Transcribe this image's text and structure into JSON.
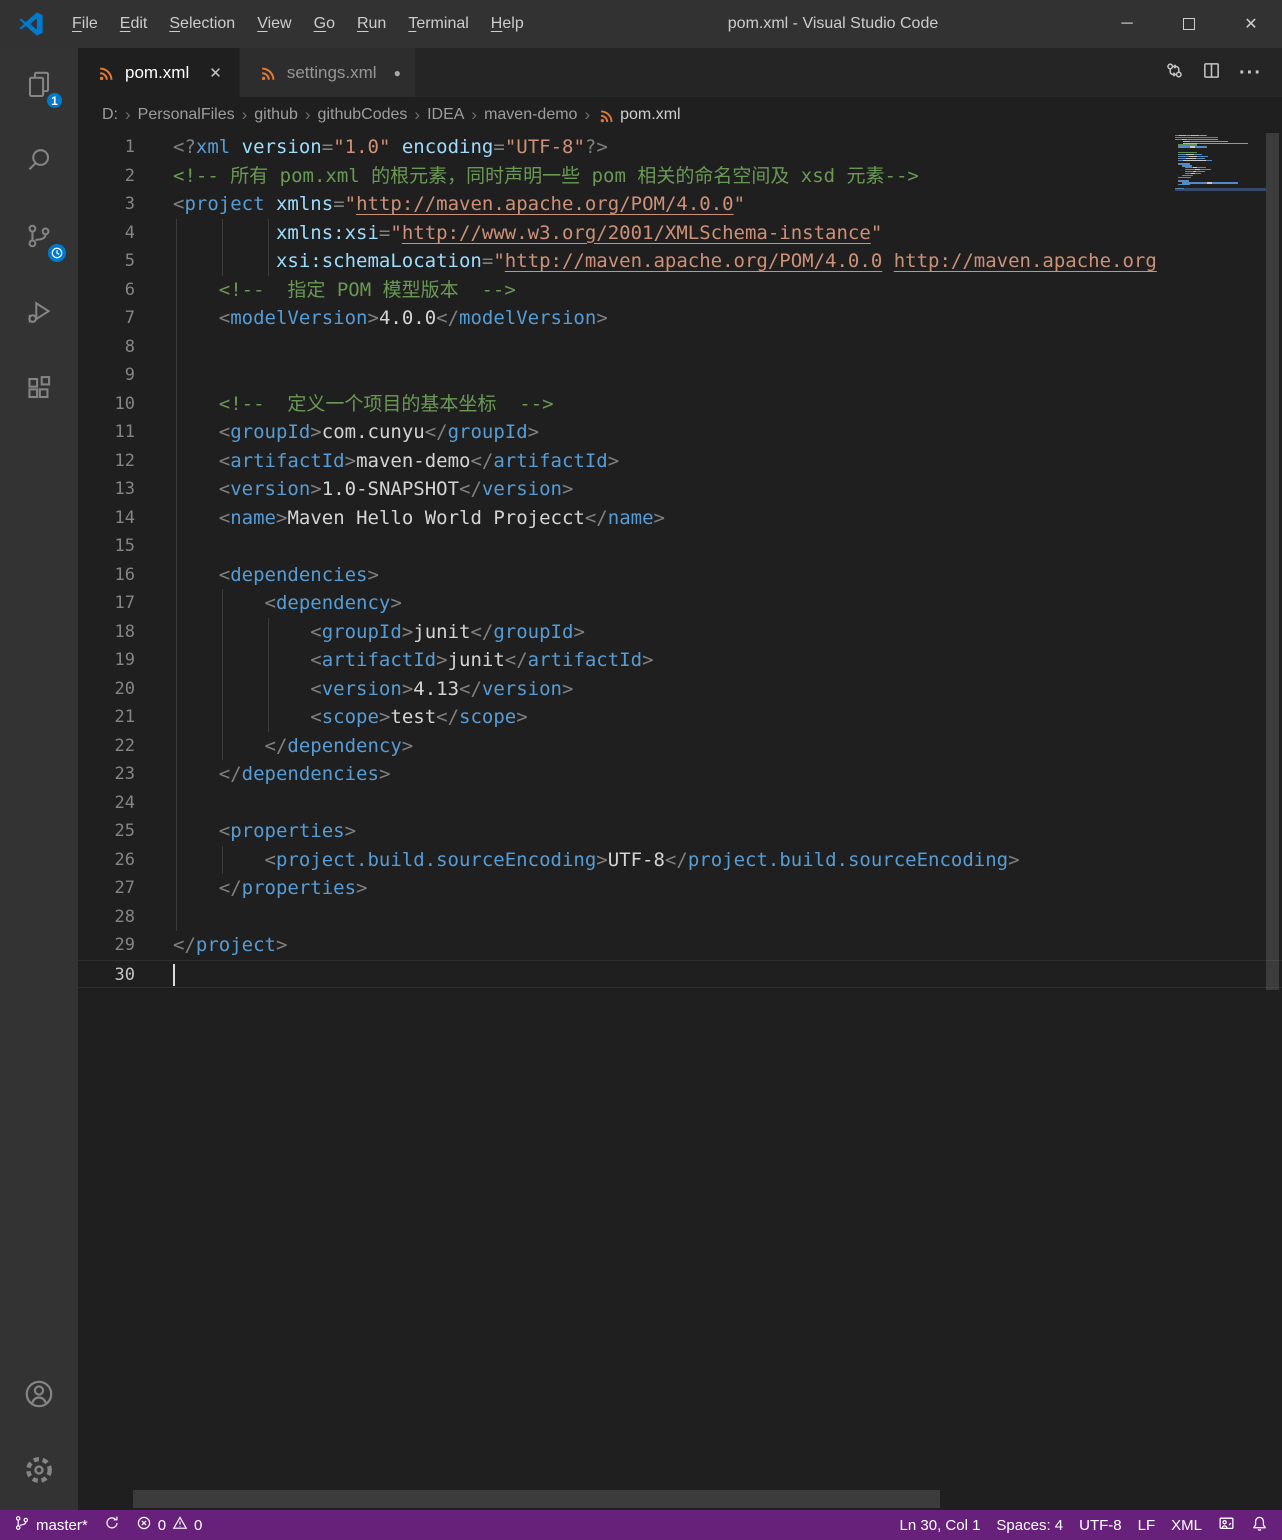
{
  "window": {
    "title": "pom.xml - Visual Studio Code",
    "controls": {
      "minimize": "─",
      "close": "✕"
    }
  },
  "menu": {
    "items": [
      "File",
      "Edit",
      "Selection",
      "View",
      "Go",
      "Run",
      "Terminal",
      "Help"
    ]
  },
  "activity_bar": {
    "explorer_badge": "1",
    "items": [
      "explorer",
      "search",
      "source-control",
      "run-and-debug",
      "extensions"
    ],
    "bottom_items": [
      "accounts",
      "manage"
    ]
  },
  "tab_bar": {
    "tabs": [
      {
        "label": "pom.xml",
        "state": "active",
        "close_glyph": "✕"
      },
      {
        "label": "settings.xml",
        "state": "modified",
        "dot_glyph": "●"
      }
    ],
    "more_glyph": "···"
  },
  "breadcrumb": {
    "path": [
      "D:",
      "PersonalFiles",
      "github",
      "githubCodes",
      "IDEA",
      "maven-demo"
    ],
    "file": "pom.xml",
    "separator": "›"
  },
  "editor": {
    "cursor": {
      "line": 30,
      "col": 1
    },
    "lines": [
      {
        "n": 1,
        "ind": 0,
        "g": [],
        "segs": [
          [
            "pu",
            "<?"
          ],
          [
            "tag",
            "xml"
          ],
          [
            "txt",
            " "
          ],
          [
            "attr",
            "version"
          ],
          [
            "pu",
            "="
          ],
          [
            "str",
            "\"1.0\""
          ],
          [
            "txt",
            " "
          ],
          [
            "attr",
            "encoding"
          ],
          [
            "pu",
            "="
          ],
          [
            "str",
            "\"UTF-8\""
          ],
          [
            "pu",
            "?>"
          ]
        ]
      },
      {
        "n": 2,
        "ind": 0,
        "g": [],
        "segs": [
          [
            "com",
            "<!-- 所有 pom.xml 的根元素，同时声明一些 pom 相关的命名空间及 xsd 元素-->"
          ]
        ]
      },
      {
        "n": 3,
        "ind": 0,
        "g": [],
        "segs": [
          [
            "pu",
            "<"
          ],
          [
            "tag",
            "project"
          ],
          [
            "txt",
            " "
          ],
          [
            "attr",
            "xmlns"
          ],
          [
            "pu",
            "="
          ],
          [
            "str",
            "\""
          ],
          [
            "url",
            "http://maven.apache.org/POM/4.0.0"
          ],
          [
            "str",
            "\""
          ]
        ]
      },
      {
        "n": 4,
        "ind": 9,
        "g": [
          0,
          4,
          8
        ],
        "segs": [
          [
            "attr",
            "xmlns:xsi"
          ],
          [
            "pu",
            "="
          ],
          [
            "str",
            "\""
          ],
          [
            "url",
            "http://www.w3.org/2001/XMLSchema-instance"
          ],
          [
            "str",
            "\""
          ]
        ]
      },
      {
        "n": 5,
        "ind": 9,
        "g": [
          0,
          4,
          8
        ],
        "segs": [
          [
            "attr",
            "xsi:schemaLocation"
          ],
          [
            "pu",
            "="
          ],
          [
            "str",
            "\""
          ],
          [
            "url",
            "http://maven.apache.org/POM/4.0.0"
          ],
          [
            "str",
            " "
          ],
          [
            "url",
            "http://maven.apache.org"
          ]
        ]
      },
      {
        "n": 6,
        "ind": 4,
        "g": [
          0
        ],
        "segs": [
          [
            "com",
            "<!--  指定 POM 模型版本  -->"
          ]
        ]
      },
      {
        "n": 7,
        "ind": 4,
        "g": [
          0
        ],
        "segs": [
          [
            "pu",
            "<"
          ],
          [
            "tag",
            "modelVersion"
          ],
          [
            "pu",
            ">"
          ],
          [
            "txt",
            "4.0.0"
          ],
          [
            "pu",
            "</"
          ],
          [
            "tag",
            "modelVersion"
          ],
          [
            "pu",
            ">"
          ]
        ]
      },
      {
        "n": 8,
        "ind": 0,
        "g": [
          0
        ],
        "segs": []
      },
      {
        "n": 9,
        "ind": 0,
        "g": [
          0
        ],
        "segs": []
      },
      {
        "n": 10,
        "ind": 4,
        "g": [
          0
        ],
        "segs": [
          [
            "com",
            "<!--  定义一个项目的基本坐标  -->"
          ]
        ]
      },
      {
        "n": 11,
        "ind": 4,
        "g": [
          0
        ],
        "segs": [
          [
            "pu",
            "<"
          ],
          [
            "tag",
            "groupId"
          ],
          [
            "pu",
            ">"
          ],
          [
            "txt",
            "com.cunyu"
          ],
          [
            "pu",
            "</"
          ],
          [
            "tag",
            "groupId"
          ],
          [
            "pu",
            ">"
          ]
        ]
      },
      {
        "n": 12,
        "ind": 4,
        "g": [
          0
        ],
        "segs": [
          [
            "pu",
            "<"
          ],
          [
            "tag",
            "artifactId"
          ],
          [
            "pu",
            ">"
          ],
          [
            "txt",
            "maven-demo"
          ],
          [
            "pu",
            "</"
          ],
          [
            "tag",
            "artifactId"
          ],
          [
            "pu",
            ">"
          ]
        ]
      },
      {
        "n": 13,
        "ind": 4,
        "g": [
          0
        ],
        "segs": [
          [
            "pu",
            "<"
          ],
          [
            "tag",
            "version"
          ],
          [
            "pu",
            ">"
          ],
          [
            "txt",
            "1.0-SNAPSHOT"
          ],
          [
            "pu",
            "</"
          ],
          [
            "tag",
            "version"
          ],
          [
            "pu",
            ">"
          ]
        ]
      },
      {
        "n": 14,
        "ind": 4,
        "g": [
          0
        ],
        "segs": [
          [
            "pu",
            "<"
          ],
          [
            "tag",
            "name"
          ],
          [
            "pu",
            ">"
          ],
          [
            "txt",
            "Maven Hello World Projecct"
          ],
          [
            "pu",
            "</"
          ],
          [
            "tag",
            "name"
          ],
          [
            "pu",
            ">"
          ]
        ]
      },
      {
        "n": 15,
        "ind": 0,
        "g": [
          0
        ],
        "segs": []
      },
      {
        "n": 16,
        "ind": 4,
        "g": [
          0
        ],
        "segs": [
          [
            "pu",
            "<"
          ],
          [
            "tag",
            "dependencies"
          ],
          [
            "pu",
            ">"
          ]
        ]
      },
      {
        "n": 17,
        "ind": 8,
        "g": [
          0,
          4
        ],
        "segs": [
          [
            "pu",
            "<"
          ],
          [
            "tag",
            "dependency"
          ],
          [
            "pu",
            ">"
          ]
        ]
      },
      {
        "n": 18,
        "ind": 12,
        "g": [
          0,
          4,
          8
        ],
        "segs": [
          [
            "pu",
            "<"
          ],
          [
            "tag",
            "groupId"
          ],
          [
            "pu",
            ">"
          ],
          [
            "txt",
            "junit"
          ],
          [
            "pu",
            "</"
          ],
          [
            "tag",
            "groupId"
          ],
          [
            "pu",
            ">"
          ]
        ]
      },
      {
        "n": 19,
        "ind": 12,
        "g": [
          0,
          4,
          8
        ],
        "segs": [
          [
            "pu",
            "<"
          ],
          [
            "tag",
            "artifactId"
          ],
          [
            "pu",
            ">"
          ],
          [
            "txt",
            "junit"
          ],
          [
            "pu",
            "</"
          ],
          [
            "tag",
            "artifactId"
          ],
          [
            "pu",
            ">"
          ]
        ]
      },
      {
        "n": 20,
        "ind": 12,
        "g": [
          0,
          4,
          8
        ],
        "segs": [
          [
            "pu",
            "<"
          ],
          [
            "tag",
            "version"
          ],
          [
            "pu",
            ">"
          ],
          [
            "txt",
            "4.13"
          ],
          [
            "pu",
            "</"
          ],
          [
            "tag",
            "version"
          ],
          [
            "pu",
            ">"
          ]
        ]
      },
      {
        "n": 21,
        "ind": 12,
        "g": [
          0,
          4,
          8
        ],
        "segs": [
          [
            "pu",
            "<"
          ],
          [
            "tag",
            "scope"
          ],
          [
            "pu",
            ">"
          ],
          [
            "txt",
            "test"
          ],
          [
            "pu",
            "</"
          ],
          [
            "tag",
            "scope"
          ],
          [
            "pu",
            ">"
          ]
        ]
      },
      {
        "n": 22,
        "ind": 8,
        "g": [
          0,
          4
        ],
        "segs": [
          [
            "pu",
            "</"
          ],
          [
            "tag",
            "dependency"
          ],
          [
            "pu",
            ">"
          ]
        ]
      },
      {
        "n": 23,
        "ind": 4,
        "g": [
          0
        ],
        "segs": [
          [
            "pu",
            "</"
          ],
          [
            "tag",
            "dependencies"
          ],
          [
            "pu",
            ">"
          ]
        ]
      },
      {
        "n": 24,
        "ind": 0,
        "g": [
          0
        ],
        "segs": []
      },
      {
        "n": 25,
        "ind": 4,
        "g": [
          0
        ],
        "segs": [
          [
            "pu",
            "<"
          ],
          [
            "tag",
            "properties"
          ],
          [
            "pu",
            ">"
          ]
        ]
      },
      {
        "n": 26,
        "ind": 8,
        "g": [
          0,
          4
        ],
        "segs": [
          [
            "pu",
            "<"
          ],
          [
            "tag",
            "project.build.sourceEncoding"
          ],
          [
            "pu",
            ">"
          ],
          [
            "txt",
            "UTF-8"
          ],
          [
            "pu",
            "</"
          ],
          [
            "tag",
            "project.build.sourceEncoding"
          ],
          [
            "pu",
            ">"
          ]
        ]
      },
      {
        "n": 27,
        "ind": 4,
        "g": [
          0
        ],
        "segs": [
          [
            "pu",
            "</"
          ],
          [
            "tag",
            "properties"
          ],
          [
            "pu",
            ">"
          ]
        ]
      },
      {
        "n": 28,
        "ind": 0,
        "g": [
          0
        ],
        "segs": []
      },
      {
        "n": 29,
        "ind": 0,
        "g": [],
        "segs": [
          [
            "pu",
            "</"
          ],
          [
            "tag",
            "project"
          ],
          [
            "pu",
            ">"
          ]
        ]
      },
      {
        "n": 30,
        "ind": 0,
        "g": [],
        "segs": [],
        "cur": true
      }
    ]
  },
  "status_bar": {
    "branch": "master*",
    "errors": "0",
    "warnings": "0",
    "position": "Ln 30, Col 1",
    "indentation": "Spaces: 4",
    "encoding": "UTF-8",
    "eol": "LF",
    "language": "XML"
  },
  "colors": {
    "status_bg": "#68217a",
    "badge_accent": "#007acc",
    "xml_icon": "#e37933",
    "syntax": {
      "tag": "#569cd6",
      "attr": "#9cdcfe",
      "string": "#ce9178",
      "comment": "#6a9955",
      "punct": "#808080",
      "text": "#d4d4d4"
    }
  }
}
